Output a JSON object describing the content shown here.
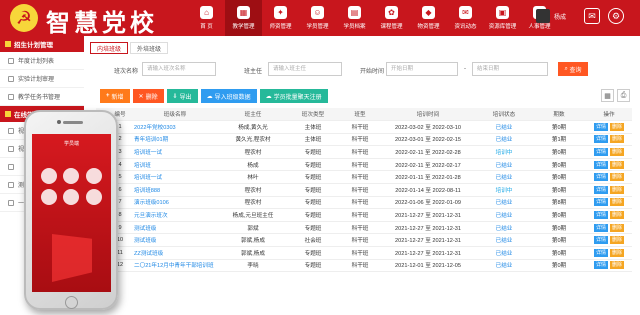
{
  "app": {
    "brand": "智慧党校",
    "emblem": "☭",
    "user_name": "杨成"
  },
  "nav": [
    {
      "label": "首 页",
      "icon": "home-icon",
      "glyph": "⌂"
    },
    {
      "label": "教学管理",
      "icon": "teach-icon",
      "glyph": "▦"
    },
    {
      "label": "师资管理",
      "icon": "teacher-icon",
      "glyph": "✦"
    },
    {
      "label": "学员管理",
      "icon": "student-icon",
      "glyph": "☺"
    },
    {
      "label": "学员档案",
      "icon": "archive-icon",
      "glyph": "▤"
    },
    {
      "label": "课程管理",
      "icon": "course-icon",
      "glyph": "✿"
    },
    {
      "label": "物资管理",
      "icon": "supply-icon",
      "glyph": "◆"
    },
    {
      "label": "资讯动态",
      "icon": "news-icon",
      "glyph": "✉"
    },
    {
      "label": "资源库管理",
      "icon": "resource-icon",
      "glyph": "▣"
    },
    {
      "label": "人事管理",
      "icon": "hr-icon",
      "glyph": "♟"
    }
  ],
  "sidebar": {
    "section1": "招生计划管理",
    "items1": [
      "年度计划列表",
      "实验计划审理",
      "教学任务书管理"
    ],
    "section2": "在线学习系统",
    "items2": [
      "视频课程管理",
      "视频",
      "",
      "测",
      "一课"
    ]
  },
  "tabs": [
    "内培班级",
    "外培班级"
  ],
  "filters": {
    "name_label": "班次名称",
    "name_placeholder": "请输入班次名称",
    "head_label": "班主任",
    "head_placeholder": "请输入班主任",
    "time_label": "开始时间",
    "start_placeholder": "开始日期",
    "sep": "-",
    "end_placeholder": "结束日期",
    "search_label": "查询"
  },
  "toolbar": [
    {
      "label": "新增",
      "glyph": "+",
      "color": "#ff7a1a",
      "name": "add-button"
    },
    {
      "label": "删除",
      "glyph": "✕",
      "color": "#ff5722",
      "name": "delete-button"
    },
    {
      "label": "导出",
      "glyph": "⇩",
      "color": "#26b99a",
      "name": "export-button"
    },
    {
      "label": "导入班级数据",
      "glyph": "☁",
      "color": "#2f9cf0",
      "name": "import-class-button"
    },
    {
      "label": "学员批量聚天注册",
      "glyph": "☁",
      "color": "#26b99a",
      "name": "batch-register-button"
    }
  ],
  "table": {
    "headers": [
      "",
      "编号",
      "班级名称",
      "班主任",
      "班次类型",
      "班型",
      "培训时间",
      "培训状态",
      "期数",
      "操作"
    ],
    "edit_label": "详情",
    "del_label": "删除",
    "rows": [
      [
        "1",
        "2022年党校0303",
        "杨成,黄久光",
        "主体班",
        "科干班",
        "2022-03-02 至 2022-03-10",
        "已结业",
        "第0期"
      ],
      [
        "2",
        "青年培训01期",
        "黄久光,程农村",
        "主体班",
        "科干班",
        "2022-03-01 至 2022-02-15",
        "已结业",
        "第1期"
      ],
      [
        "3",
        "培训班一试",
        "程农村",
        "专题班",
        "科干班",
        "2022-02-11 至 2022-02-28",
        "培训中",
        "第0期"
      ],
      [
        "4",
        "培训班",
        "杨成",
        "专题班",
        "科干班",
        "2022-02-11 至 2022-02-17",
        "已结业",
        "第0期"
      ],
      [
        "5",
        "培训班一试",
        "林叶",
        "专题班",
        "科干班",
        "2022-01-11 至 2022-01-28",
        "已结业",
        "第0期"
      ],
      [
        "6",
        "培训班888",
        "程农村",
        "专题班",
        "科干班",
        "2022-01-14 至 2022-08-11",
        "培训中",
        "第0期"
      ],
      [
        "7",
        "演示班级0106",
        "程农村",
        "专题班",
        "科干班",
        "2022-01-06 至 2022-01-09",
        "已结业",
        "第8期"
      ],
      [
        "8",
        "元旦演示班次",
        "杨成,元旦班主任",
        "专题班",
        "科干班",
        "2021-12-27 至 2021-12-31",
        "已结业",
        "第0期"
      ],
      [
        "9",
        "测试班级",
        "郭斌",
        "专题班",
        "科干班",
        "2021-12-27 至 2021-12-31",
        "已结业",
        "第0期"
      ],
      [
        "10",
        "测试班级",
        "郭斌,杨成",
        "社会班",
        "科干班",
        "2021-12-27 至 2021-12-31",
        "已结业",
        "第0期"
      ],
      [
        "11",
        "ZZ测试班级",
        "郭斌,杨成",
        "专题班",
        "科干班",
        "2021-12-27 至 2021-12-31",
        "已结业",
        "第0期"
      ],
      [
        "12",
        "二〇21年12月中青年干部培训班",
        "李晓",
        "专题班",
        "科干班",
        "2021-12-01 至 2021-12-05",
        "已结业",
        "第0期"
      ]
    ]
  },
  "phone": {
    "screen_title": "学员端"
  }
}
